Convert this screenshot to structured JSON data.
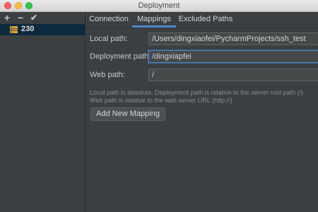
{
  "window": {
    "title": "Deployment"
  },
  "toolbar": {
    "add_label": "+",
    "remove_label": "−",
    "check_label": "✔"
  },
  "servers": [
    {
      "label": "230",
      "icon": "server-icon"
    }
  ],
  "tabs": [
    {
      "label": "Connection",
      "active": false
    },
    {
      "label": "Mappings",
      "active": true
    },
    {
      "label": "Excluded Paths",
      "active": false
    }
  ],
  "mappings": {
    "local_path_label": "Local path:",
    "local_path_value": "/Users/dingxiaofei/PycharmProjects/ssh_test",
    "deployment_path_label": "Deployment path:",
    "deployment_path_value": "/dingxiapfei",
    "web_path_label": "Web path:",
    "web_path_value": "/",
    "hint_line1": "Local path is absolute. Deployment path is relative to the server root path (/).",
    "hint_line2": "Web path is relative to the web server URL (http://).",
    "add_mapping_label": "Add New Mapping"
  },
  "colors": {
    "accent": "#4a88c7",
    "selection": "#0d293e",
    "background": "#3c3f41"
  }
}
